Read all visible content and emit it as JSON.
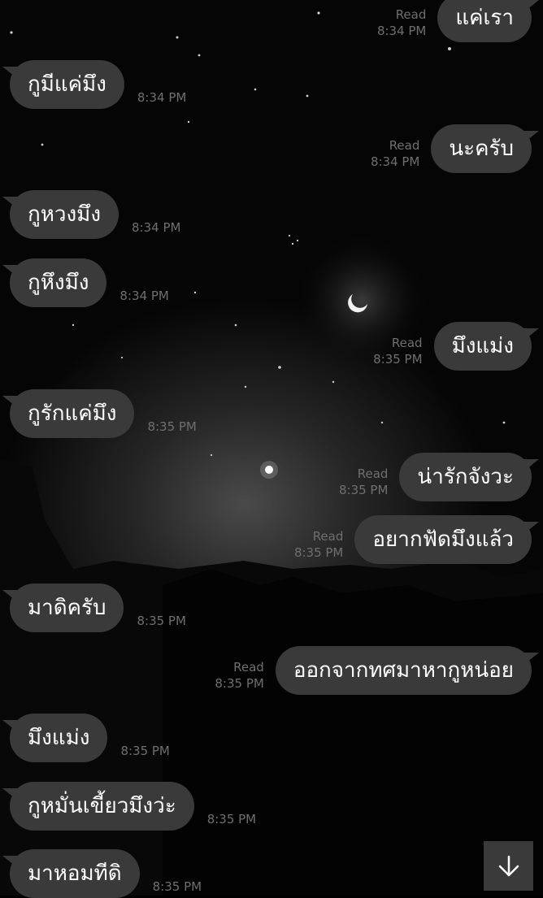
{
  "read_label": "Read",
  "messages": [
    {
      "side": "out",
      "text": "แค่เรา",
      "time": "8:34 PM",
      "read": true
    },
    {
      "side": "in",
      "text": "กูมีแค่มึง",
      "time": "8:34 PM"
    },
    {
      "side": "out",
      "text": "นะครับ",
      "time": "8:34 PM",
      "read": true
    },
    {
      "side": "in",
      "text": "กูหวงมึง",
      "time": "8:34 PM"
    },
    {
      "side": "in",
      "text": "กูหึงมึง",
      "time": "8:34 PM"
    },
    {
      "side": "out",
      "text": "มึงแม่ง",
      "time": "8:35 PM",
      "read": true
    },
    {
      "side": "in",
      "text": "กูรักแค่มึง",
      "time": "8:35 PM"
    },
    {
      "side": "out",
      "text": "น่ารักจังวะ",
      "time": "8:35 PM",
      "read": true
    },
    {
      "side": "out",
      "text": "อยากฟัดมึงแล้ว",
      "time": "8:35 PM",
      "read": true
    },
    {
      "side": "in",
      "text": "มาดิครับ",
      "time": "8:35 PM"
    },
    {
      "side": "out",
      "text": "ออกจากทศมาหากูหน่อย",
      "time": "8:35 PM",
      "read": true
    },
    {
      "side": "in",
      "text": "มึงแม่ง",
      "time": "8:35 PM"
    },
    {
      "side": "in",
      "text": "กูหมั่นเขี้ยวมึงว่ะ",
      "time": "8:35 PM"
    },
    {
      "side": "in",
      "text": "มาหอมทีดิ",
      "time": "8:35 PM"
    }
  ],
  "scroll_button_icon": "arrow-down-icon",
  "colors": {
    "bubble": "#3a3a3a",
    "bubble_text": "#ffffff",
    "meta_text": "#6f6f6f",
    "background": "#000000"
  }
}
